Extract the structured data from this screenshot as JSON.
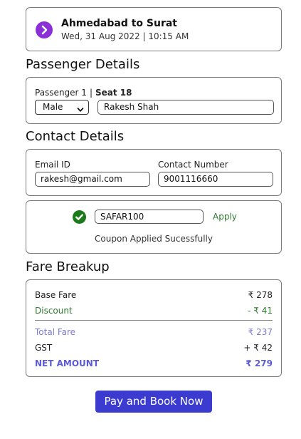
{
  "journey": {
    "route": "Ahmedabad to Surat",
    "date_time": "Wed, 31 Aug 2022 | 10:15 AM",
    "icon": "chevron-right-circle-icon",
    "icon_color": "#8b2fd9"
  },
  "passenger": {
    "heading": "Passenger Details",
    "label": "Passenger 1",
    "separator": "|",
    "seat": "Seat 18",
    "gender": "Male",
    "name": "Rakesh Shah"
  },
  "contact": {
    "heading": "Contact Details",
    "email_label": "Email ID",
    "email_value": "rakesh@gmail.com",
    "phone_label": "Contact Number",
    "phone_value": "9001116660"
  },
  "coupon": {
    "code": "SAFAR100",
    "apply_label": "Apply",
    "status": "Coupon Applied Sucessfully",
    "status_icon": "check-circle-icon",
    "status_color": "#1a7a1a"
  },
  "fare": {
    "heading": "Fare Breakup",
    "rows": [
      {
        "label": "Base Fare",
        "amount": "₹ 278"
      },
      {
        "label": "Discount",
        "amount": "- ₹ 41"
      },
      {
        "label": "Total Fare",
        "amount": "₹ 237"
      },
      {
        "label": "GST",
        "amount": "+ ₹ 42"
      },
      {
        "label": "NET AMOUNT",
        "amount": "₹ 279"
      }
    ]
  },
  "actions": {
    "pay_label": "Pay and Book Now",
    "pay_color": "#3b3bcf"
  }
}
